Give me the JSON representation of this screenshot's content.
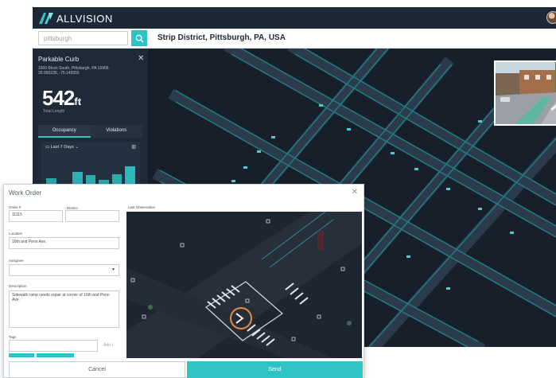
{
  "app": {
    "brand": "ALLVISION"
  },
  "search": {
    "value": "pittsburgh",
    "placeholder": "pittsburgh"
  },
  "location": {
    "title": "Strip District, Pittsburgh, PA, USA"
  },
  "panel": {
    "title": "Parkable Curb",
    "address": "1600 Block South, Pittsburgh, PA 15906",
    "coords": "39.950235, -75.145555",
    "metric_value": "542",
    "metric_unit": "ft",
    "metric_label": "Total Length",
    "tabs": [
      {
        "label": "Occupancy",
        "active": true
      },
      {
        "label": "Violations",
        "active": false
      }
    ],
    "range_label": "Last 7 Days",
    "occupancy_levels": [
      0.55,
      0.35,
      0.7,
      0.62,
      0.5,
      0.65,
      0.85
    ]
  },
  "work_order": {
    "title": "Work Order",
    "order_label": "Order #",
    "order_value": "11115",
    "district_label": "District",
    "district_value": "",
    "location_label": "Location",
    "location_value": "16th and Penn Ave.",
    "assignee_label": "Assignee",
    "assignee_value": "",
    "description_label": "Description",
    "description_value": "Sidewalk ramp needs repair at corner of 16th and Penn Ave.",
    "tags_label": "Tags",
    "add_label": "Add +",
    "observation_label": "Last Observation",
    "cancel_label": "Cancel",
    "send_label": "Send"
  },
  "colors": {
    "accent": "#2ec4c6",
    "dark_bg": "#1b2532",
    "road": "#2a3a4a"
  },
  "icons": {
    "logo": "allvision-logo-icon",
    "search": "search-icon",
    "close": "close-icon",
    "calendar": "calendar-icon",
    "chevron": "chevron-down-icon",
    "chart": "bar-chart-icon"
  }
}
